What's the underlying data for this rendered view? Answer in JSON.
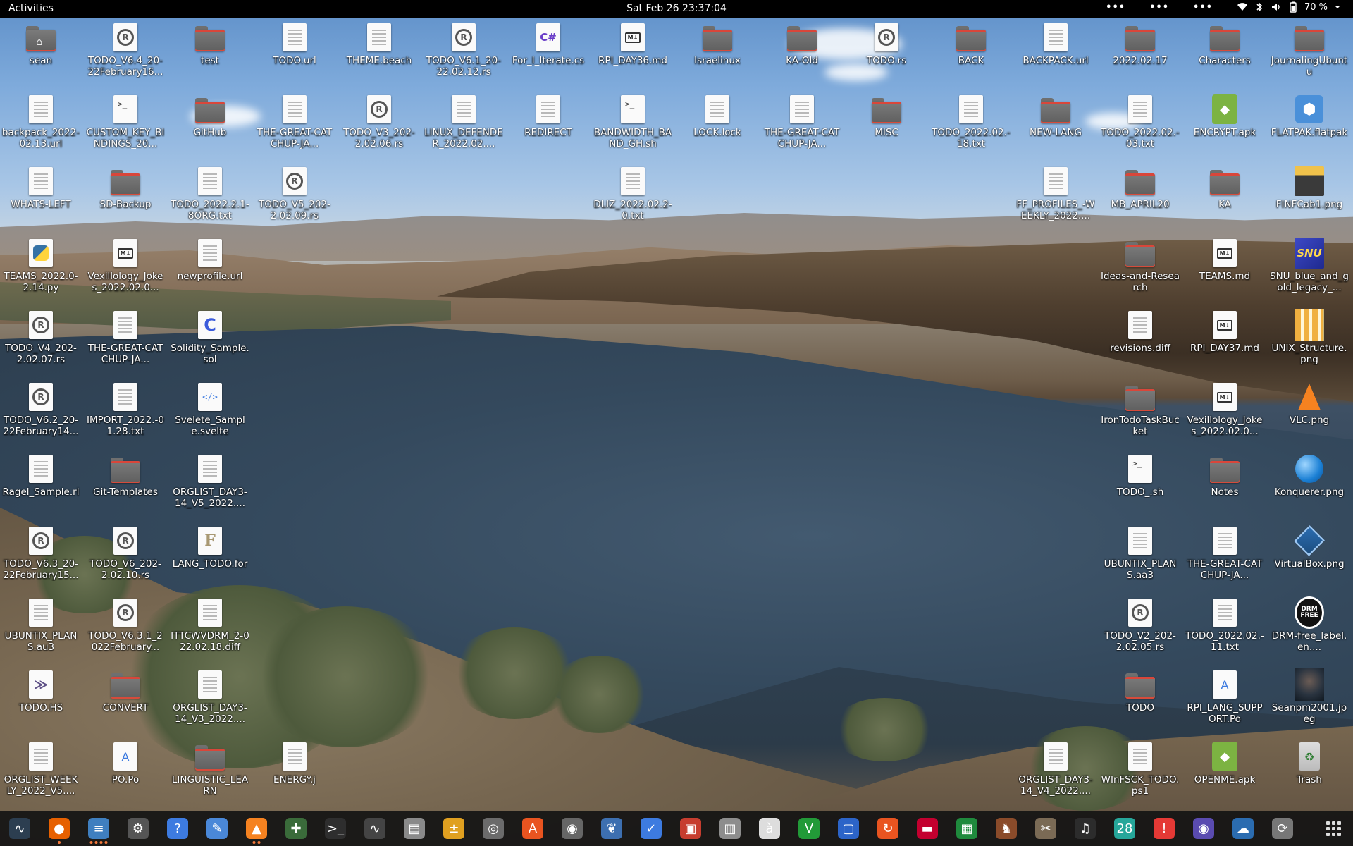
{
  "topbar": {
    "activities": "Activities",
    "clock": "Sat Feb 26  23:37:04",
    "tray_dots": [
      "•••",
      "•••",
      "•••"
    ],
    "battery": "70 %"
  },
  "desktop": {
    "icons": [
      {
        "label": "sean",
        "kind": "folder-home"
      },
      {
        "label": "TODO_V6.4_20-22February16...",
        "kind": "rs"
      },
      {
        "label": "test",
        "kind": "folder"
      },
      {
        "label": "TODO.url",
        "kind": "doc"
      },
      {
        "label": "THEME.beach",
        "kind": "doc"
      },
      {
        "label": "TODO_V6.1_20-22.02.12.rs",
        "kind": "rs"
      },
      {
        "label": "For_I_Iterate.cs",
        "kind": "cs"
      },
      {
        "label": "RPI_DAY36.md",
        "kind": "md"
      },
      {
        "label": "Israelinux",
        "kind": "folder"
      },
      {
        "label": "KA-Old",
        "kind": "folder"
      },
      {
        "label": "TODO.rs",
        "kind": "rs"
      },
      {
        "label": "BACK",
        "kind": "folder"
      },
      {
        "label": "BACKPACK.url",
        "kind": "doc"
      },
      {
        "label": "2022.02.17",
        "kind": "folder"
      },
      {
        "label": "Characters",
        "kind": "folder"
      },
      {
        "label": "JournalingUbuntu",
        "kind": "folder"
      },
      {
        "label": "backpack_2022-02.13.url",
        "kind": "doc"
      },
      {
        "label": "CUSTOM_KEY_BINDINGS_20...",
        "kind": "term"
      },
      {
        "label": "GitHub",
        "kind": "folder"
      },
      {
        "label": "THE-GREAT-CATCHUP-JA...",
        "kind": "doc"
      },
      {
        "label": "TODO_V3_202-2.02.06.rs",
        "kind": "rs"
      },
      {
        "label": "LINUX_DEFENDER_2022.02....",
        "kind": "doc"
      },
      {
        "label": "REDIRECT",
        "kind": "doc"
      },
      {
        "label": "BANDWIDTH_BAND_GH.sh",
        "kind": "term"
      },
      {
        "label": "LOCK.lock",
        "kind": "doc"
      },
      {
        "label": "THE-GREAT-CATCHUP-JA...",
        "kind": "doc"
      },
      {
        "label": "MISC",
        "kind": "folder"
      },
      {
        "label": "TODO_2022.02.-18.txt",
        "kind": "doc"
      },
      {
        "label": "NEW-LANG",
        "kind": "folder"
      },
      {
        "label": "TODO_2022.02.-03.txt",
        "kind": "doc"
      },
      {
        "label": "ENCRYPT.apk",
        "kind": "apk"
      },
      {
        "label": "FLATPAK.flatpak",
        "kind": "flatpak"
      },
      {
        "label": "WHATS-LEFT",
        "kind": "doc"
      },
      {
        "label": "SD-Backup",
        "kind": "folder"
      },
      {
        "label": "TODO_2022.2.1-8ORG.txt",
        "kind": "doc"
      },
      {
        "label": "TODO_V5_202-2.02.09.rs",
        "kind": "rs"
      },
      {
        "label": "DLIZ_2022.02.2-0.txt",
        "kind": "doc"
      },
      {
        "label": "FF_PROFILES_-WEEKLY_2022....",
        "kind": "doc"
      },
      {
        "label": "MB_APRIL20",
        "kind": "folder"
      },
      {
        "label": "KA",
        "kind": "folder"
      },
      {
        "label": "FINFCab1.png",
        "kind": "cab"
      },
      {
        "label": "TEAMS_2022.0-2.14.py",
        "kind": "py"
      },
      {
        "label": "Vexillology_Jokes_2022.02.0...",
        "kind": "md"
      },
      {
        "label": "newprofile.url",
        "kind": "doc"
      },
      {
        "label": "Ideas-and-Research",
        "kind": "folder"
      },
      {
        "label": "TEAMS.md",
        "kind": "md"
      },
      {
        "label": "SNU_blue_and_gold_legacy_...",
        "kind": "snu"
      },
      {
        "label": "TODO_V4_202-2.02.07.rs",
        "kind": "rs"
      },
      {
        "label": "THE-GREAT-CATCHUP-JA...",
        "kind": "doc"
      },
      {
        "label": "Solidity_Sample.sol",
        "kind": "c"
      },
      {
        "label": "revisions.diff",
        "kind": "doc"
      },
      {
        "label": "RPI_DAY37.md",
        "kind": "md"
      },
      {
        "label": "UNIX_Structure.png",
        "kind": "unix"
      },
      {
        "label": "TODO_V6.2_20-22February14...",
        "kind": "rs"
      },
      {
        "label": "IMPORT_2022.-01.28.txt",
        "kind": "doc"
      },
      {
        "label": "Svelete_Sample.svelte",
        "kind": "code"
      },
      {
        "label": "IronTodoTaskBucket",
        "kind": "folder"
      },
      {
        "label": "Vexillology_Jokes_2022.02.0...",
        "kind": "md"
      },
      {
        "label": "VLC.png",
        "kind": "vlc"
      },
      {
        "label": "Ragel_Sample.rl",
        "kind": "doc"
      },
      {
        "label": "Git-Templates",
        "kind": "folder"
      },
      {
        "label": "ORGLIST_DAY3-14_V5_2022....",
        "kind": "doc"
      },
      {
        "label": "TODO_.sh",
        "kind": "term"
      },
      {
        "label": "Notes",
        "kind": "folder"
      },
      {
        "label": "Konquerer.png",
        "kind": "globe"
      },
      {
        "label": "TODO_V6.3_20-22February15...",
        "kind": "rs"
      },
      {
        "label": "TODO_V6_202-2.02.10.rs",
        "kind": "rs"
      },
      {
        "label": "LANG_TODO.for",
        "kind": "f"
      },
      {
        "label": "UBUNTIX_PLANS.aa3",
        "kind": "doc"
      },
      {
        "label": "THE-GREAT-CATCHUP-JA...",
        "kind": "doc"
      },
      {
        "label": "VirtualBox.png",
        "kind": "vbox"
      },
      {
        "label": "UBUNTIX_PLANS.au3",
        "kind": "doc"
      },
      {
        "label": "TODO_V6.3.1_2022February...",
        "kind": "rs"
      },
      {
        "label": "ITTCWVDRM_2-022.02.18.diff",
        "kind": "doc"
      },
      {
        "label": "TODO_V2_202-2.02.05.rs",
        "kind": "rs"
      },
      {
        "label": "TODO_2022.02.-11.txt",
        "kind": "doc"
      },
      {
        "label": "DRM-free_label.en....",
        "kind": "drm"
      },
      {
        "label": "TODO.HS",
        "kind": "hs"
      },
      {
        "label": "CONVERT",
        "kind": "folder"
      },
      {
        "label": "ORGLIST_DAY3-14_V3_2022....",
        "kind": "doc"
      },
      {
        "label": "TODO",
        "kind": "folder"
      },
      {
        "label": "RPI_LANG_SUPPORT.Po",
        "kind": "po"
      },
      {
        "label": "Seanpm2001.jpeg",
        "kind": "photo"
      },
      {
        "label": "ORGLIST_WEEKLY_2022_V5....",
        "kind": "doc"
      },
      {
        "label": "PO.Po",
        "kind": "po"
      },
      {
        "label": "LINGUISTIC_LEARN",
        "kind": "folder"
      },
      {
        "label": "ENERGY.j",
        "kind": "doc"
      },
      {
        "label": "ORGLIST_DAY3-14_V4_2022....",
        "kind": "doc"
      },
      {
        "label": "WInFSCK_TODO.ps1",
        "kind": "doc"
      },
      {
        "label": "OPENME.apk",
        "kind": "apk"
      },
      {
        "label": "Trash",
        "kind": "trash"
      }
    ]
  },
  "dock": {
    "items": [
      {
        "name": "system-monitor-icon",
        "glyph": "∿",
        "bg": "#2c3e50"
      },
      {
        "name": "firefox-icon",
        "glyph": "●",
        "bg": "#e66000",
        "running": 1
      },
      {
        "name": "text-editor-icon",
        "glyph": "≡",
        "bg": "#3f7fbf",
        "running": 4
      },
      {
        "name": "settings-icon",
        "glyph": "⚙",
        "bg": "#555"
      },
      {
        "name": "help-icon",
        "glyph": "?",
        "bg": "#3d7be0"
      },
      {
        "name": "notes-icon",
        "glyph": "✎",
        "bg": "#4a88d8"
      },
      {
        "name": "vlc-icon",
        "glyph": "▲",
        "bg": "#f58220",
        "running": 2
      },
      {
        "name": "extension-icon",
        "glyph": "✚",
        "bg": "#3a6b3a"
      },
      {
        "name": "terminal-icon",
        "glyph": ">_",
        "bg": "#2e2e2e"
      },
      {
        "name": "monitor-graph-icon",
        "glyph": "∿",
        "bg": "#444"
      },
      {
        "name": "files-icon",
        "glyph": "▤",
        "bg": "#8a8a8a"
      },
      {
        "name": "calculator-icon",
        "glyph": "±",
        "bg": "#e0a020"
      },
      {
        "name": "image-viewer-icon",
        "glyph": "◎",
        "bg": "#6b6b6b"
      },
      {
        "name": "software-icon",
        "glyph": "A",
        "bg": "#e95420"
      },
      {
        "name": "disks-icon",
        "glyph": "◉",
        "bg": "#666"
      },
      {
        "name": "dictionary-icon",
        "glyph": "❦",
        "bg": "#3d6fb0"
      },
      {
        "name": "todo-icon",
        "glyph": "✓",
        "bg": "#3d7be0"
      },
      {
        "name": "document-scanner-icon",
        "glyph": "▣",
        "bg": "#c63d2f"
      },
      {
        "name": "archive-icon",
        "glyph": "▥",
        "bg": "#8d8d8d"
      },
      {
        "name": "character-map-icon",
        "glyph": "à",
        "bg": "#ddd"
      },
      {
        "name": "vim-icon",
        "glyph": "V",
        "bg": "#229a38"
      },
      {
        "name": "screenshot-icon",
        "glyph": "▢",
        "bg": "#2c64c8"
      },
      {
        "name": "backup-icon",
        "glyph": "↻",
        "bg": "#e95420"
      },
      {
        "name": "pdf-icon",
        "glyph": "▬",
        "bg": "#c3002f"
      },
      {
        "name": "spreadsheet-icon",
        "glyph": "▦",
        "bg": "#1f8a3d"
      },
      {
        "name": "game-icon",
        "glyph": "♞",
        "bg": "#8a4b2a"
      },
      {
        "name": "gimp-icon",
        "glyph": "✂",
        "bg": "#7a6a55"
      },
      {
        "name": "music-icon",
        "glyph": "♫",
        "bg": "#2c2c2c"
      },
      {
        "name": "calendar-icon",
        "glyph": "28",
        "bg": "#26a69a"
      },
      {
        "name": "alert-icon",
        "glyph": "!",
        "bg": "#e53935"
      },
      {
        "name": "screen-recorder-icon",
        "glyph": "◉",
        "bg": "#5a4bb0"
      },
      {
        "name": "weather-icon",
        "glyph": "☁",
        "bg": "#2b6cb0"
      },
      {
        "name": "updater-icon",
        "glyph": "⟳",
        "bg": "#777"
      }
    ],
    "show_apps": "show-apps-grid"
  }
}
